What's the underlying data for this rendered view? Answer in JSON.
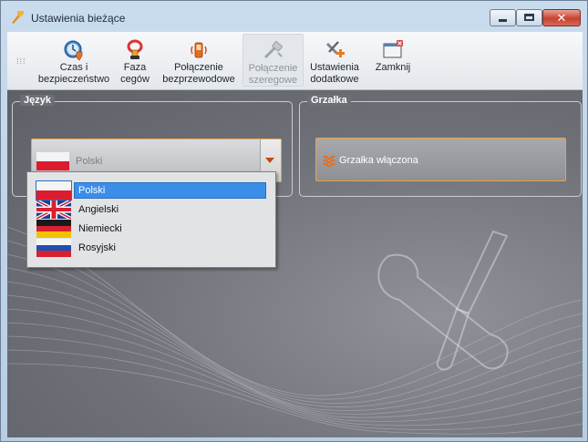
{
  "window": {
    "title": "Ustawienia bieżące",
    "close_glyph": "✕"
  },
  "toolbar": {
    "items": [
      {
        "label": "Czas i bezpieczeństwo",
        "icon": "clock-shield-icon"
      },
      {
        "label": "Faza cegów",
        "icon": "clamp-phase-icon"
      },
      {
        "label": "Połączenie bezprzewodowe",
        "icon": "wireless-phone-icon"
      },
      {
        "label": "Połączenie szeregowe",
        "icon": "serial-cable-icon",
        "disabled": true
      },
      {
        "label": "Ustawienia dodatkowe",
        "icon": "tools-plus-icon"
      },
      {
        "label": "Zamknij",
        "icon": "close-window-icon"
      }
    ]
  },
  "language_group": {
    "title": "Język",
    "selected": "Polski",
    "options": [
      {
        "name": "Polski",
        "flag": "poland",
        "selected": true
      },
      {
        "name": "Angielski",
        "flag": "uk"
      },
      {
        "name": "Niemiecki",
        "flag": "germany"
      },
      {
        "name": "Rosyjski",
        "flag": "russia"
      }
    ]
  },
  "heater_group": {
    "title": "Grzałka",
    "button_label": "Grzałka włączona"
  },
  "colors": {
    "accent_orange": "#f0a040",
    "selection_blue": "#3b8ee8",
    "content_bg": "#6e7178"
  }
}
